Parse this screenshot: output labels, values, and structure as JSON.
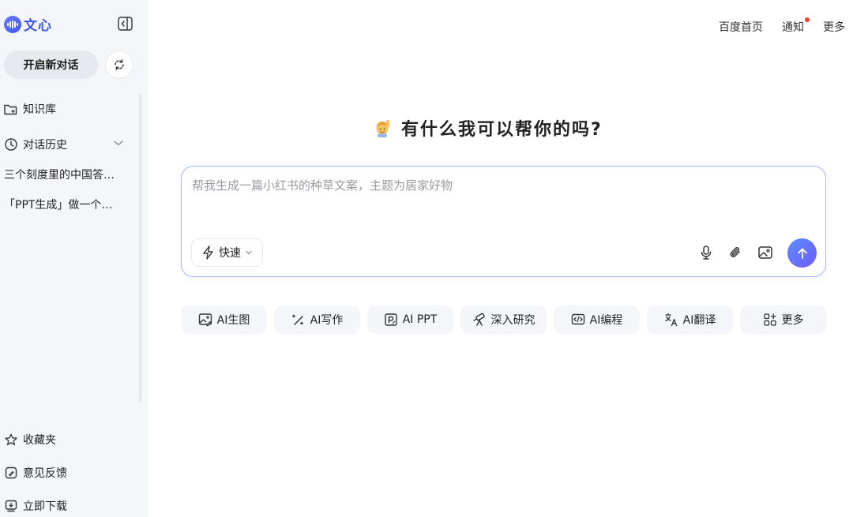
{
  "brand": {
    "name": "文心"
  },
  "sidebar": {
    "new_chat_label": "开启新对话",
    "nav": {
      "knowledge": "知识库",
      "history": "对话历史"
    },
    "history_items": [
      "三个刻度里的中国答…",
      "「PPT生成」做一个…"
    ],
    "bottom": {
      "favorites": "收藏夹",
      "feedback": "意见反馈",
      "download": "立即下载"
    }
  },
  "header": {
    "links": [
      "百度首页",
      "通知",
      "更多"
    ]
  },
  "main": {
    "headline": "有什么我可以帮你的吗?",
    "input": {
      "placeholder": "帮我生成一篇小红书的种草文案，主题为居家好物",
      "value": ""
    },
    "mode_label": "快速",
    "chips": [
      "AI生图",
      "AI写作",
      "AI PPT",
      "深入研究",
      "AI编程",
      "AI翻译",
      "更多"
    ]
  },
  "colors": {
    "brand": "#3a55f1",
    "send_gradient_start": "#5b8cff",
    "send_gradient_end": "#6f5cf6",
    "input_border": "#a9b3f7",
    "notification_dot": "#ff3b30"
  }
}
